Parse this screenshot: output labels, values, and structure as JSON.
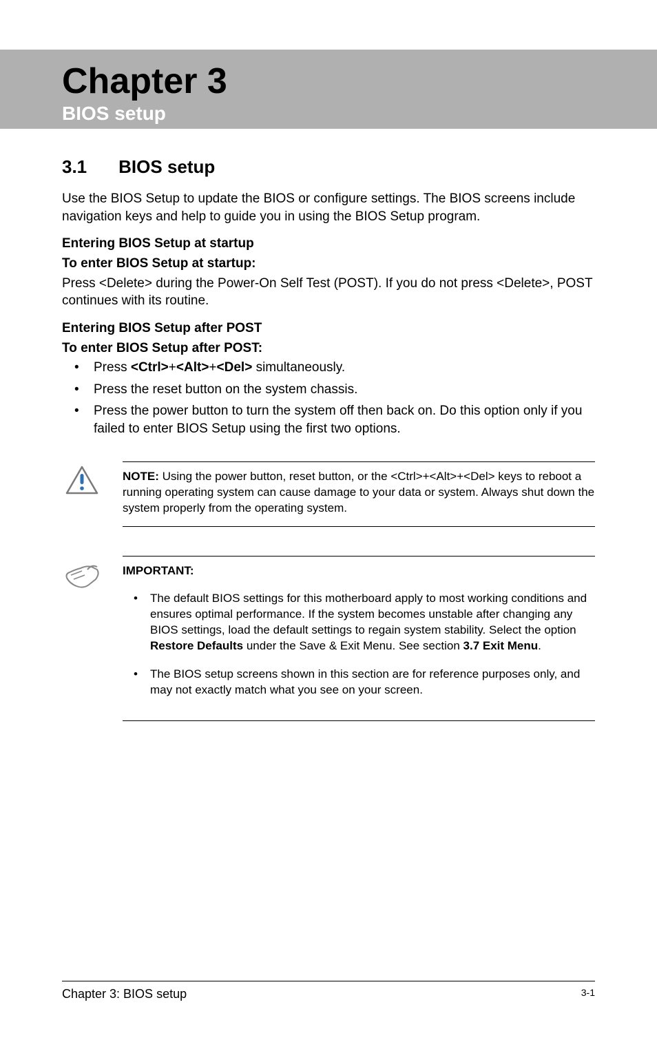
{
  "header": {
    "chapter_title": "Chapter 3",
    "chapter_subtitle": "BIOS setup"
  },
  "section": {
    "number": "3.1",
    "name": "BIOS setup"
  },
  "intro_paragraph": "Use the BIOS Setup to update the BIOS or configure settings. The BIOS screens include navigation keys and help to guide you in using the BIOS Setup program.",
  "startup": {
    "heading1": "Entering BIOS Setup at startup",
    "heading2": "To enter BIOS Setup at startup:",
    "body": "Press <Delete> during the Power-On Self Test (POST). If you do not press <Delete>, POST continues with its routine."
  },
  "after_post": {
    "heading1": "Entering BIOS Setup after POST",
    "heading2": "To enter BIOS Setup after POST:",
    "bullets": [
      {
        "prefix": "Press ",
        "bold": "<Ctrl>",
        "mid1": "+",
        "bold2": "<Alt>",
        "mid2": "+",
        "bold3": "<Del>",
        "suffix": " simultaneously."
      },
      {
        "text": "Press the reset button on the system chassis."
      },
      {
        "text": "Press the power button to turn the system off then back on. Do this option only if you failed to enter BIOS Setup using the first two options."
      }
    ]
  },
  "note_callout": {
    "label": "NOTE:",
    "text": "   Using the power button, reset button, or the <Ctrl>+<Alt>+<Del> keys to reboot a running operating system can cause damage to your data or system. Always shut down the system properly from the operating system."
  },
  "important_callout": {
    "label": "IMPORTANT:",
    "items": [
      {
        "pre": "The default BIOS settings for this motherboard apply to most working conditions and ensures optimal performance. If the system becomes unstable after changing any BIOS settings, load the default settings to regain system stability. Select the option ",
        "bold1": "Restore Defaults",
        "mid": " under the Save & Exit Menu. See section ",
        "bold2": "3.7 Exit Menu",
        "post": "."
      },
      {
        "text": "The BIOS setup screens shown in this section are for reference purposes only, and may not exactly match what you see on your screen."
      }
    ]
  },
  "footer": {
    "left": "Chapter 3: BIOS setup",
    "right": "3-1"
  }
}
